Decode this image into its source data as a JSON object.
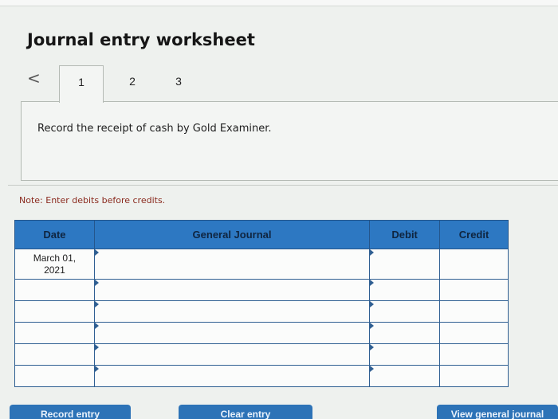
{
  "page": {
    "title": "Journal entry worksheet"
  },
  "tabs": {
    "prev_icon": "chevron-left-icon",
    "prev_glyph": "<",
    "items": [
      {
        "label": "1",
        "active": true
      },
      {
        "label": "2",
        "active": false
      },
      {
        "label": "3",
        "active": false
      }
    ]
  },
  "instruction": "Record the receipt of cash by Gold Examiner.",
  "note": "Note: Enter debits before credits.",
  "journal": {
    "headers": [
      "Date",
      "General Journal",
      "Debit",
      "Credit"
    ],
    "rows": [
      {
        "date": "March 01,\n2021",
        "account": "",
        "debit": "",
        "credit": ""
      },
      {
        "date": "",
        "account": "",
        "debit": "",
        "credit": ""
      },
      {
        "date": "",
        "account": "",
        "debit": "",
        "credit": ""
      },
      {
        "date": "",
        "account": "",
        "debit": "",
        "credit": ""
      },
      {
        "date": "",
        "account": "",
        "debit": "",
        "credit": ""
      },
      {
        "date": "",
        "account": "",
        "debit": "",
        "credit": ""
      }
    ]
  },
  "buttons": {
    "record": "Record entry",
    "clear": "Clear entry",
    "view": "View general journal"
  },
  "colors": {
    "header_blue": "#2d78c2",
    "button_blue": "#2d73b7",
    "note_red": "#8a2a1e"
  }
}
